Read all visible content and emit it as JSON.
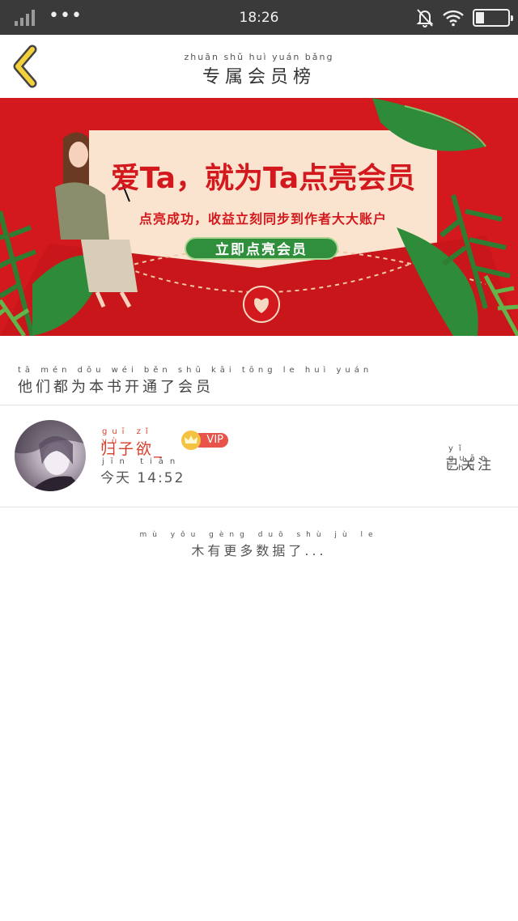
{
  "status_bar": {
    "time": "18:26",
    "dots": "•••"
  },
  "header": {
    "title": "专属会员榜",
    "title_pinyin": "zhuān shǔ huì yuán bǎng"
  },
  "banner": {
    "headline": "爱Ta，就为Ta点亮会员",
    "subtitle": "点亮成功，收益立刻同步到作者大大账户",
    "button_label": "立即点亮会员"
  },
  "section": {
    "title": "他们都为本书开通了会员",
    "title_pinyin": "tā mén dōu wéi běn shū kāi tōng le huì yuán"
  },
  "members": [
    {
      "name": "归子欲_",
      "name_pinyin": "guī zǐ yù",
      "vip_label": "VIP",
      "time": "今天 14:52",
      "time_pinyin": "jīn tiān",
      "follow_label": "已关注",
      "follow_pinyin": "yǐ guān zhù"
    }
  ],
  "footer": {
    "no_more": "木有更多数据了...",
    "no_more_pinyin": "mù yǒu gèng duō shù jù le"
  },
  "colors": {
    "banner_red": "#d3191d",
    "button_green": "#2f8f3c",
    "name_red": "#d6402a",
    "vip_red": "#e8534a",
    "crown_gold": "#f4c241",
    "back_arrow": "#f3d13a"
  }
}
